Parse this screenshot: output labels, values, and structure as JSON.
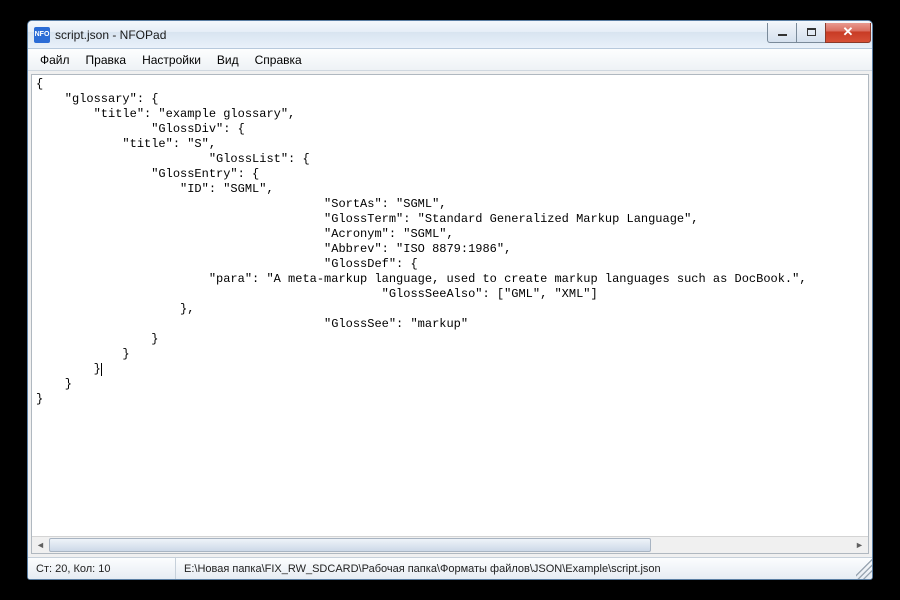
{
  "window": {
    "title": "script.json - NFOPad",
    "icon_label": "NFO"
  },
  "menu": {
    "items": [
      "Файл",
      "Правка",
      "Настройки",
      "Вид",
      "Справка"
    ]
  },
  "editor": {
    "lines": [
      "{",
      "    \"glossary\": {",
      "        \"title\": \"example glossary\",",
      "\t\t\"GlossDiv\": {",
      "            \"title\": \"S\",",
      "\t\t\t\"GlossList\": {",
      "                \"GlossEntry\": {",
      "                    \"ID\": \"SGML\",",
      "\t\t\t\t\t\"SortAs\": \"SGML\",",
      "\t\t\t\t\t\"GlossTerm\": \"Standard Generalized Markup Language\",",
      "\t\t\t\t\t\"Acronym\": \"SGML\",",
      "\t\t\t\t\t\"Abbrev\": \"ISO 8879:1986\",",
      "\t\t\t\t\t\"GlossDef\": {",
      "                        \"para\": \"A meta-markup language, used to create markup languages such as DocBook.\",",
      "\t\t\t\t\t\t\"GlossSeeAlso\": [\"GML\", \"XML\"]",
      "                    },",
      "\t\t\t\t\t\"GlossSee\": \"markup\"",
      "                }",
      "            }",
      "        }",
      "    }",
      "}"
    ],
    "cursor_line_index": 19,
    "cursor_after_text": "        }"
  },
  "statusbar": {
    "position": "Ст: 20, Кол: 10",
    "path": "E:\\Новая папка\\FIX_RW_SDCARD\\Рабочая папка\\Форматы файлов\\JSON\\Example\\script.json"
  }
}
